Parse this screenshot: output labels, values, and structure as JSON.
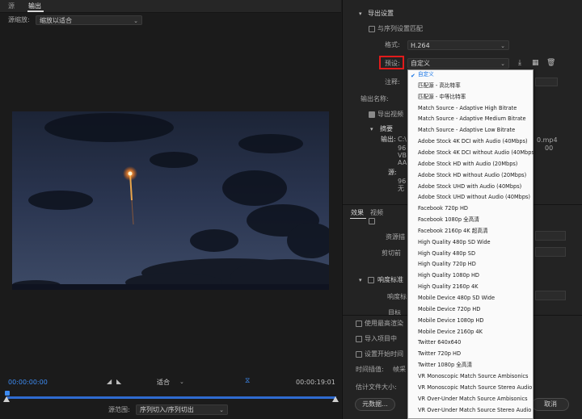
{
  "left": {
    "tabs": [
      "源",
      "输出"
    ],
    "source_scaling_label": "源缩放:",
    "source_scaling_value": "缩放以适合",
    "timecode_start": "00:00:00:00",
    "fit_value": "适合",
    "timecode_end": "00:00:19:01",
    "range_label": "源范围:",
    "range_value": "序列切入/序列切出"
  },
  "right": {
    "export_settings": "导出设置",
    "match_sequence": "与序列设置匹配",
    "format_label": "格式:",
    "format_value": "H.264",
    "preset_label": "预设:",
    "preset_value": "自定义",
    "comment_label": "注释:",
    "output_name_label": "输出名称:",
    "export_video": "导出视频",
    "summary_label": "摘要",
    "output_label": "输出:",
    "output_lines": [
      "C:\\",
      "96",
      "VB",
      "AA"
    ],
    "output_right_lines": [
      "0.mp4",
      "00"
    ],
    "source_label": "源:",
    "source_lines": [
      "96",
      "无"
    ],
    "tabs": [
      "效果",
      "视频"
    ],
    "panel_rows": [
      "资源描",
      "剪切前"
    ],
    "brightness_label": "响度标准",
    "brightness_sub": [
      "响度标",
      "目标"
    ],
    "use_max_render": "使用最高渲染",
    "import_project": "导入项目中",
    "set_start_time": "设置开始时间",
    "time_interp_label": "时间插值:",
    "time_interp_value": "帧采",
    "estimate_size_label": "估计文件大小:",
    "metadata_button": "元数据...",
    "cancel_button": "取消"
  },
  "preset_menu": {
    "items": [
      "自定义",
      "匹配源 - 高比特率",
      "匹配源 - 中等比特率",
      "Match Source - Adaptive High Bitrate",
      "Match Source - Adaptive Medium Bitrate",
      "Match Source - Adaptive Low Bitrate",
      "Adobe Stock 4K DCI with Audio (40Mbps)",
      "Adobe Stock 4K DCI without Audio (40Mbps)",
      "Adobe Stock HD with Audio (20Mbps)",
      "Adobe Stock HD without Audio (20Mbps)",
      "Adobe Stock UHD with Audio (40Mbps)",
      "Adobe Stock UHD without Audio (40Mbps)",
      "Facebook 720p HD",
      "Facebook 1080p 全高清",
      "Facebook 2160p 4K 超高清",
      "High Quality 480p SD Wide",
      "High Quality 480p SD",
      "High Quality 720p HD",
      "High Quality 1080p HD",
      "High Quality 2160p 4K",
      "Mobile Device 480p SD Wide",
      "Mobile Device 720p HD",
      "Mobile Device 1080p HD",
      "Mobile Device 2160p 4K",
      "Twitter 640x640",
      "Twitter 720p HD",
      "Twitter 1080p 全高清",
      "VR Monoscopic Match Source Ambisonics",
      "VR Monoscopic Match Source Stereo Audio",
      "VR Over-Under Match Source Ambisonics",
      "VR Over-Under Match Source Stereo Audio"
    ],
    "selected_index": 0
  },
  "colors": {
    "accent_blue": "#1473e6",
    "timeline_blue": "#2f6bd0",
    "highlight_red": "#e21b1b"
  }
}
